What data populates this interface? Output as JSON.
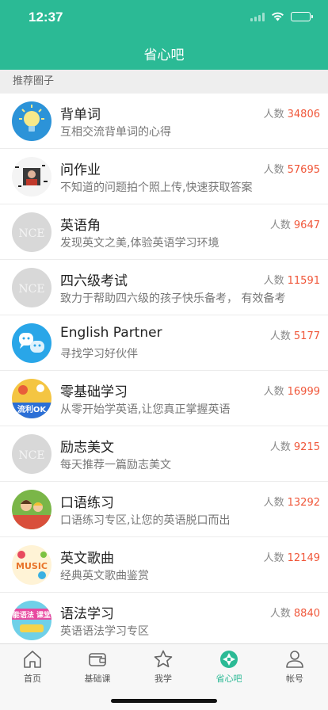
{
  "status": {
    "time": "12:37"
  },
  "nav": {
    "title": "省心吧"
  },
  "section": {
    "header": "推荐圈子"
  },
  "colors": {
    "accent": "#2bba95",
    "count": "#f0573a"
  },
  "circles": [
    {
      "title": "背单词",
      "desc": "互相交流背单词的心得",
      "count_label": "人数",
      "count": "34806",
      "icon": "lightbulb-icon"
    },
    {
      "title": "问作业",
      "desc": "不知道的问题拍个照上传,快速获取答案",
      "count_label": "人数",
      "count": "57695",
      "icon": "homework-photo"
    },
    {
      "title": "英语角",
      "desc": "发现英文之美,体验英语学习环境",
      "count_label": "人数",
      "count": "9647",
      "icon": "nce-placeholder",
      "avatar_text": "NCE"
    },
    {
      "title": "四六级考试",
      "desc": "致力于帮助四六级的孩子快乐备考，  有效备考",
      "count_label": "人数",
      "count": "11591",
      "icon": "nce-placeholder",
      "avatar_text": "NCE"
    },
    {
      "title": "English Partner",
      "desc": "寻找学习好伙伴",
      "count_label": "人数",
      "count": "5177",
      "icon": "chat-bubbles-icon"
    },
    {
      "title": "零基础学习",
      "desc": "从零开始学英语,让您真正掌握英语",
      "count_label": "人数",
      "count": "16999",
      "icon": "fluent-english-image",
      "avatar_text": "流利OK"
    },
    {
      "title": "励志美文",
      "desc": "每天推荐一篇励志美文",
      "count_label": "人数",
      "count": "9215",
      "icon": "nce-placeholder",
      "avatar_text": "NCE"
    },
    {
      "title": "口语练习",
      "desc": "口语练习专区,让您的英语脱口而出",
      "count_label": "人数",
      "count": "13292",
      "icon": "speaking-kids-image"
    },
    {
      "title": "英文歌曲",
      "desc": "经典英文歌曲鉴赏",
      "count_label": "人数",
      "count": "12149",
      "icon": "music-notes-image",
      "avatar_text": "MUSIC"
    },
    {
      "title": "语法学习",
      "desc": "英语语法学习专区",
      "count_label": "人数",
      "count": "8840",
      "icon": "grammar-class-image",
      "avatar_text": "能语法 课堂"
    }
  ],
  "tabs": [
    {
      "label": "首页",
      "icon": "home-icon",
      "active": false
    },
    {
      "label": "基础课",
      "icon": "wallet-icon",
      "active": false
    },
    {
      "label": "我学",
      "icon": "star-icon",
      "active": false
    },
    {
      "label": "省心吧",
      "icon": "aperture-icon",
      "active": true
    },
    {
      "label": "帐号",
      "icon": "person-icon",
      "active": false
    }
  ]
}
